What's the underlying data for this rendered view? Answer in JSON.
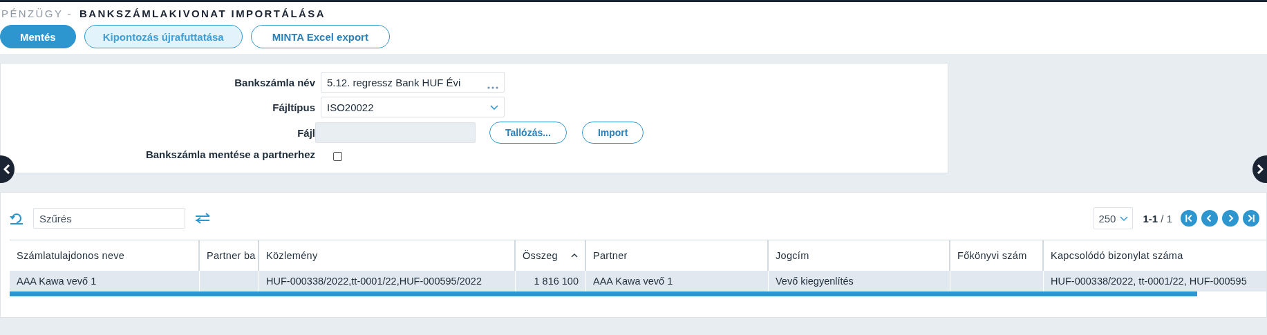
{
  "breadcrumb": {
    "section": "PÉNZÜGY -",
    "title": "BANKSZÁMLAKIVONAT IMPORTÁLÁSA"
  },
  "toolbar": [
    {
      "label": "Mentés",
      "kind": "primary"
    },
    {
      "label": "Kipontozás újrafuttatása",
      "kind": "secondary"
    },
    {
      "label": "MINTA Excel export",
      "kind": "outline"
    }
  ],
  "form": {
    "bank_account": {
      "label": "Bankszámla név",
      "value": "5.12. regressz Bank HUF Évi"
    },
    "file_type": {
      "label": "Fájltípus",
      "value": "ISO20022"
    },
    "file": {
      "label": "Fájl",
      "browse": "Tallózás...",
      "import": "Import"
    },
    "save_to_partner": {
      "label": "Bankszámla mentése a partnerhez",
      "checked": false
    }
  },
  "grid": {
    "filter_placeholder": "Szűrés",
    "page_size": "250",
    "range": "1-1",
    "total": "/ 1",
    "columns": [
      {
        "label": "Számlatulajdonos neve",
        "kind": "text",
        "sorted": false
      },
      {
        "label": "Partner ba",
        "kind": "text",
        "sorted": false
      },
      {
        "label": "Közlemény",
        "kind": "text",
        "sorted": false
      },
      {
        "label": "Összeg",
        "kind": "amount",
        "sorted": true
      },
      {
        "label": "Partner",
        "kind": "text",
        "sorted": false
      },
      {
        "label": "Jogcím",
        "kind": "text",
        "sorted": false
      },
      {
        "label": "Főkönyvi szám",
        "kind": "text",
        "sorted": false
      },
      {
        "label": "Kapcsolódó bizonylat száma",
        "kind": "text",
        "sorted": false
      }
    ],
    "rows": [
      {
        "selected": true,
        "cells": [
          "AAA Kawa vevő 1",
          "",
          "HUF-000338/2022,tt-0001/22,HUF-000595/2022",
          "1 816 100",
          "AAA Kawa vevő 1",
          "Vevő kiegyenlítés",
          "",
          "HUF-000338/2022, tt-0001/22, HUF-000595"
        ]
      }
    ]
  }
}
